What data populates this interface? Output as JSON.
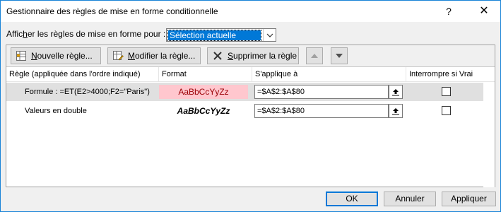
{
  "window": {
    "title": "Gestionnaire des règles de mise en forme conditionnelle",
    "help_glyph": "?",
    "close_glyph": "✕"
  },
  "show": {
    "label_pre": "Affic",
    "label_accel": "h",
    "label_post": "er les règles de mise en forme pour :",
    "selected": "Sélection actuelle"
  },
  "toolbar": {
    "new": {
      "accel": "N",
      "rest": "ouvelle règle..."
    },
    "modify": {
      "accel": "M",
      "rest": "odifier la règle..."
    },
    "delete": {
      "accel": "S",
      "rest": "upprimer la règle"
    },
    "up_icon": "move-up-icon",
    "down_icon": "move-down-icon"
  },
  "table": {
    "headers": {
      "rule": "Règle (appliquée dans l'ordre indiqué)",
      "format": "Format",
      "applies": "S'applique à",
      "stop": "Interrompre si Vrai"
    },
    "rows": [
      {
        "rule": "Formule : =ET(E2>4000;F2=\"Paris\")",
        "format_preview": "AaBbCcYyZz",
        "applies_to": "=$A$2:$A$80",
        "stop_if_true": false,
        "selected": true
      },
      {
        "rule": "Valeurs en double",
        "format_preview": "AaBbCcYyZz",
        "applies_to": "=$A$2:$A$80",
        "stop_if_true": false,
        "selected": false
      }
    ]
  },
  "dialog_buttons": {
    "ok": "OK",
    "cancel": "Annuler",
    "apply": "Appliquer"
  },
  "colors": {
    "accent": "#0078d7",
    "format1_bg": "#ffc7ce",
    "format1_fg": "#9c0006",
    "selected_row": "#e0e0e0"
  }
}
